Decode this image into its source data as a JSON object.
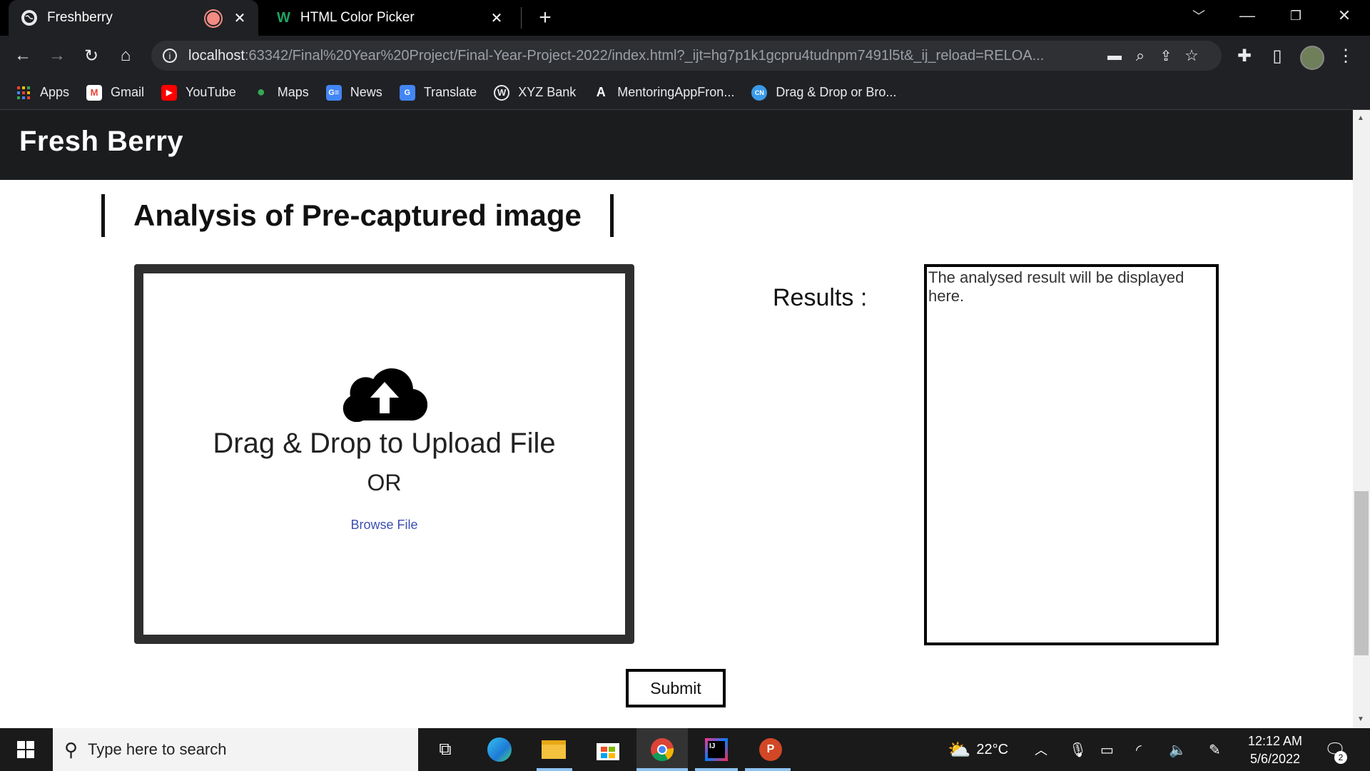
{
  "browser": {
    "tabs": [
      {
        "title": "Freshberry",
        "active": true
      },
      {
        "title": "HTML Color Picker",
        "active": false
      }
    ],
    "url_host": "localhost",
    "url_rest": ":63342/Final%20Year%20Project/Final-Year-Project-2022/index.html?_ijt=hg7p1k1gcpru4tudnpm7491l5t&_ij_reload=RELOA...",
    "bookmarks": [
      {
        "label": "Apps",
        "icon": "apps-grid-icon"
      },
      {
        "label": "Gmail",
        "icon": "gmail-icon"
      },
      {
        "label": "YouTube",
        "icon": "youtube-icon"
      },
      {
        "label": "Maps",
        "icon": "maps-icon"
      },
      {
        "label": "News",
        "icon": "news-icon"
      },
      {
        "label": "Translate",
        "icon": "translate-icon"
      },
      {
        "label": "XYZ Bank",
        "icon": "wordpress-icon"
      },
      {
        "label": "MentoringAppFron...",
        "icon": "angular-icon"
      },
      {
        "label": "Drag & Drop or Bro...",
        "icon": "codingninjas-icon"
      }
    ]
  },
  "page": {
    "brand": "Fresh Berry",
    "section_title": "Analysis of Pre-captured image",
    "dropzone": {
      "text": "Drag & Drop to Upload File",
      "or": "OR",
      "browse": "Browse File"
    },
    "results_label": "Results :",
    "results_placeholder": "The analysed result will be displayed here.",
    "submit_label": "Submit"
  },
  "taskbar": {
    "search_placeholder": "Type here to search",
    "weather": "22°C",
    "time": "12:12 AM",
    "date": "5/6/2022",
    "notifications": "2"
  },
  "colors": {
    "header_bg": "#1b1c1e",
    "dropzone_border": "#2f2f2f",
    "link": "#3c4fb2"
  }
}
